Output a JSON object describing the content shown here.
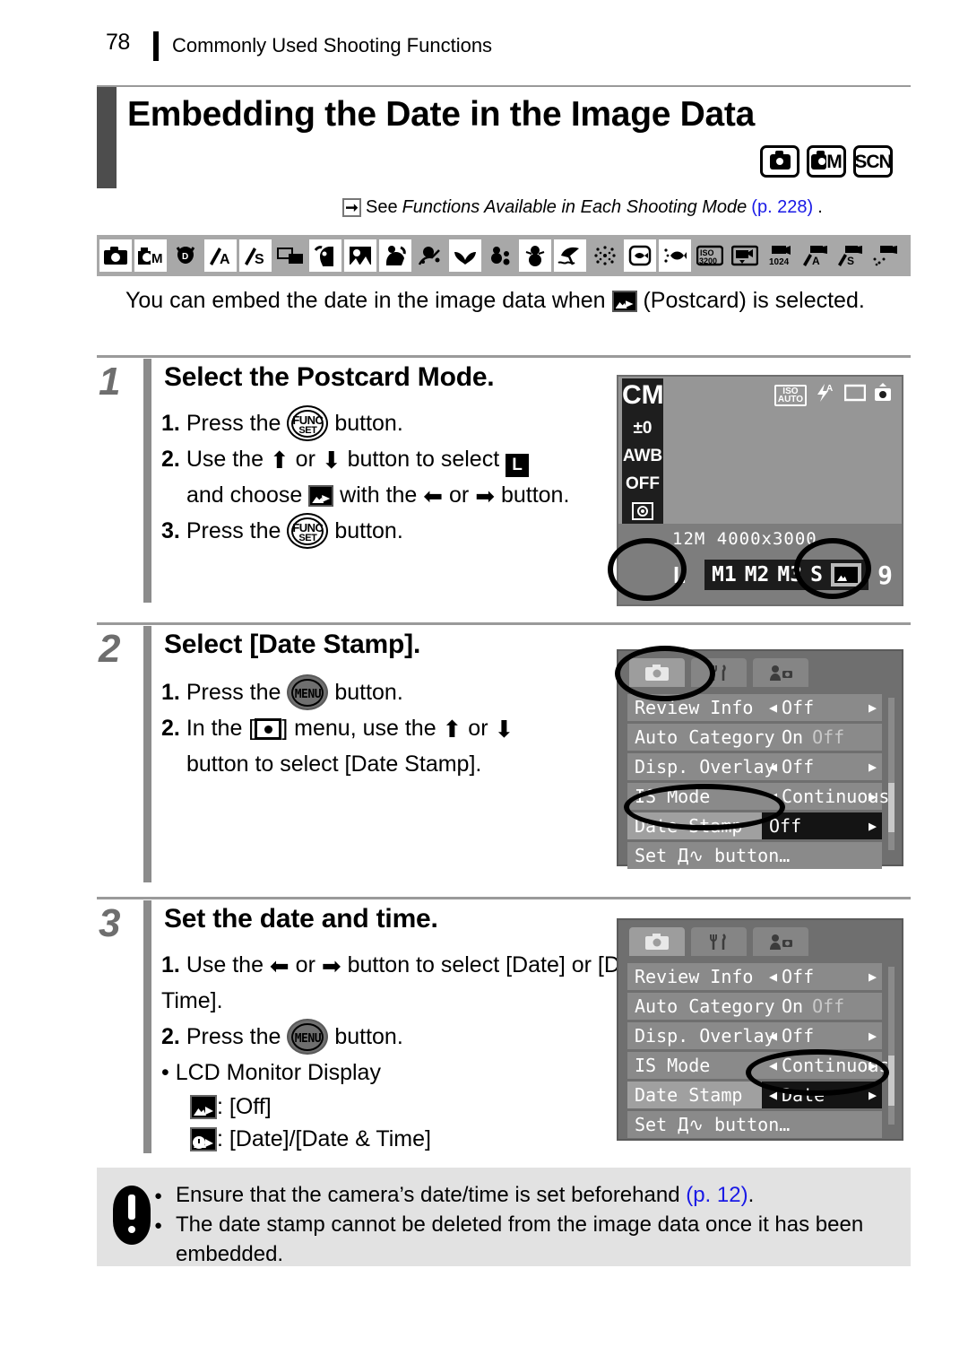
{
  "header": {
    "page_number": "78",
    "chapter": "Commonly Used Shooting Functions"
  },
  "title": "Embedding the Date in the Image Data",
  "mode_badges": [
    {
      "name": "auto-mode-badge",
      "label": ""
    },
    {
      "name": "manual-mode-badge",
      "label": "M"
    },
    {
      "name": "scn-mode-badge",
      "label": "SCN"
    }
  ],
  "see_also": {
    "prefix": "See ",
    "italic": "Functions Available in Each Shooting Mode",
    "page_ref": "(p. 228)",
    "suffix": "."
  },
  "icon_strip": [
    {
      "name": "auto-icon",
      "available": true
    },
    {
      "name": "manual-icon",
      "available": true
    },
    {
      "name": "digital-macro-icon",
      "available": false
    },
    {
      "name": "aperture-priority-icon",
      "available": true
    },
    {
      "name": "shutter-priority-icon",
      "available": true
    },
    {
      "name": "stitch-assist-icon",
      "available": false
    },
    {
      "name": "portrait-icon",
      "available": true
    },
    {
      "name": "night-snapshot-icon",
      "available": true
    },
    {
      "name": "kids-pets-icon",
      "available": true
    },
    {
      "name": "indoor-icon",
      "available": false
    },
    {
      "name": "foliage-icon",
      "available": true
    },
    {
      "name": "color-accent-icon",
      "available": false
    },
    {
      "name": "snow-icon",
      "available": true
    },
    {
      "name": "beach-icon",
      "available": true
    },
    {
      "name": "fireworks-icon",
      "available": false
    },
    {
      "name": "aquarium-icon",
      "available": true
    },
    {
      "name": "underwater-icon",
      "available": true
    },
    {
      "name": "iso3200-icon",
      "available": false
    },
    {
      "name": "movie-standard-icon",
      "available": false
    },
    {
      "name": "movie-compact-icon",
      "available": false
    },
    {
      "name": "movie-color-accent-icon",
      "available": false
    },
    {
      "name": "movie-color-swap-icon",
      "available": false
    }
  ],
  "icon_strip_labels": {
    "manual": "M",
    "aperture": "A",
    "shutter": "S",
    "iso": "ISO",
    "iso_value": "3200",
    "movie_size": "1024"
  },
  "intro": {
    "before_icon": "You can embed the date in the image data when ",
    "after_icon": " (Postcard) is selected."
  },
  "steps": [
    {
      "number": "1",
      "heading": "Select the Postcard Mode.",
      "lines": [
        {
          "num": "1.",
          "text_a": "Press the ",
          "button": "FUNC/SET",
          "text_b": " button."
        },
        {
          "num": "2.",
          "text_a": "Use the ",
          "arrows": "up-down",
          "text_b": " button to select ",
          "size": "L"
        },
        {
          "num": "",
          "text_a": "and choose ",
          "icon": "postcard",
          "text_b": " with the ",
          "arrows2": "left-right",
          "text_c": " button."
        },
        {
          "num": "3.",
          "text_a": "Press the ",
          "button": "FUNC/SET",
          "text_b": " button."
        }
      ]
    },
    {
      "number": "2",
      "heading": "Select [Date Stamp].",
      "lines": [
        {
          "num": "1.",
          "text_a": "Press the ",
          "button": "MENU",
          "text_b": " button."
        },
        {
          "num": "2.",
          "text_a": "In the [",
          "icon": "rec-menu",
          "text_b": "] menu, use the ",
          "arrows": "up-down",
          "text_c": " button to select [Date Stamp]."
        }
      ]
    },
    {
      "number": "3",
      "heading": "Set the date and time.",
      "lines": [
        {
          "num": "1.",
          "text_a": "Use the ",
          "arrows": "left-right",
          "text_b": " button to select [Date] or [Date & Time]."
        },
        {
          "num": "2.",
          "text_a": "Press the ",
          "button": "MENU",
          "text_b": " button."
        },
        {
          "bullet": "•",
          "text_a": "LCD Monitor Display"
        },
        {
          "icon": "postcard",
          "text_a": ": [Off]"
        },
        {
          "icon": "postcard-date",
          "text_a": ": [Date]/[Date & Time]"
        }
      ]
    }
  ],
  "lcd_shot_1": {
    "mode_label": "CM",
    "sidebar": [
      "±0",
      "AWB",
      "OFF"
    ],
    "top_indicators": {
      "iso_label": "ISO",
      "iso_value": "AUTO",
      "flash": "A"
    },
    "resolution_label": "12M",
    "resolution_value": "4000x3000",
    "size_options": [
      "L",
      "M1",
      "M2",
      "M3",
      "S"
    ],
    "selected_size": "L",
    "shots_remaining": "9"
  },
  "menu_shot_1": {
    "tabs": [
      "rec-tab",
      "setup-tab",
      "mytab"
    ],
    "selected_tab": "rec-tab",
    "rows": [
      {
        "label": "Review Info",
        "value": "Off",
        "type": "arrows"
      },
      {
        "label": "Auto Category",
        "value": "On",
        "value2": "Off",
        "type": "onoff"
      },
      {
        "label": "Disp. Overlay",
        "value": "Off",
        "type": "arrows"
      },
      {
        "label": "IS Mode",
        "value": "Continuous",
        "type": "arrows"
      },
      {
        "label": "Date Stamp",
        "value": "Off",
        "type": "arrows",
        "highlight": true,
        "selected": true
      },
      {
        "label": "Set Д∿ button…",
        "value": "",
        "type": "plain"
      }
    ]
  },
  "menu_shot_2": {
    "tabs": [
      "rec-tab",
      "setup-tab",
      "mytab"
    ],
    "selected_tab": "rec-tab",
    "rows": [
      {
        "label": "Review Info",
        "value": "Off",
        "type": "arrows"
      },
      {
        "label": "Auto Category",
        "value": "On",
        "value2": "Off",
        "type": "onoff"
      },
      {
        "label": "Disp. Overlay",
        "value": "Off",
        "type": "arrows"
      },
      {
        "label": "IS Mode",
        "value": "Continuous",
        "type": "arrows"
      },
      {
        "label": "Date Stamp",
        "value": "Date",
        "type": "arrows",
        "highlight": true,
        "selected": true
      },
      {
        "label": "Set Д∿ button…",
        "value": "",
        "type": "plain"
      }
    ]
  },
  "caution": {
    "items": [
      {
        "text_a": "Ensure that the camera’s date/time is set beforehand ",
        "page_ref": "(p. 12)",
        "text_b": "."
      },
      {
        "text_a": "The date stamp cannot be deleted from the image data once it has been embedded."
      }
    ]
  },
  "colors": {
    "link": "#1a1ae6",
    "step_num": "#6e6e6e",
    "rule": "#9a9a9a",
    "strip_bg": "#a8a8a8"
  }
}
